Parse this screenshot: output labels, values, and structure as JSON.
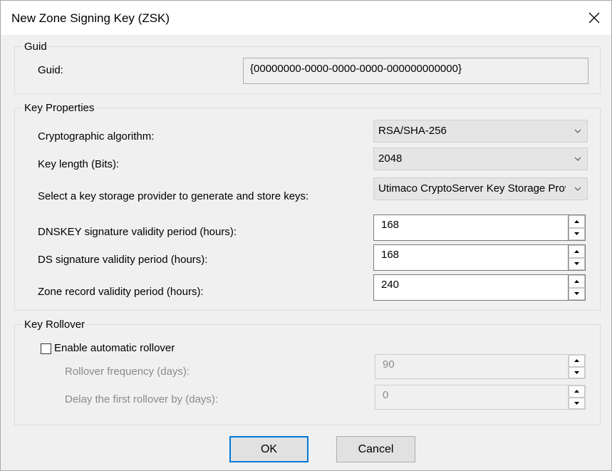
{
  "window": {
    "title": "New Zone Signing Key (ZSK)",
    "close_icon": "close-icon"
  },
  "guid_group": {
    "title": "Guid",
    "label": "Guid:",
    "value": "{00000000-0000-0000-0000-000000000000}"
  },
  "key_properties": {
    "title": "Key Properties",
    "algorithm_label": "Cryptographic algorithm:",
    "algorithm_value": "RSA/SHA-256",
    "key_length_label": "Key length (Bits):",
    "key_length_value": "2048",
    "ksp_label": "Select a key storage provider to generate and store keys:",
    "ksp_value": "Utimaco CryptoServer Key Storage Provider",
    "dnskey_label": "DNSKEY signature validity period (hours):",
    "dnskey_value": "168",
    "ds_label": "DS signature validity period (hours):",
    "ds_value": "168",
    "zone_label": "Zone record validity period (hours):",
    "zone_value": "240"
  },
  "key_rollover": {
    "title": "Key Rollover",
    "enable_label": "Enable automatic rollover",
    "enable_checked": false,
    "frequency_label": "Rollover frequency (days):",
    "frequency_value": "90",
    "delay_label": "Delay the first rollover by (days):",
    "delay_value": "0"
  },
  "buttons": {
    "ok_label": "OK",
    "cancel_label": "Cancel"
  },
  "colors": {
    "accent": "#0078d7",
    "background": "#f0f0f0",
    "disabled_text": "#8a8a8a"
  }
}
